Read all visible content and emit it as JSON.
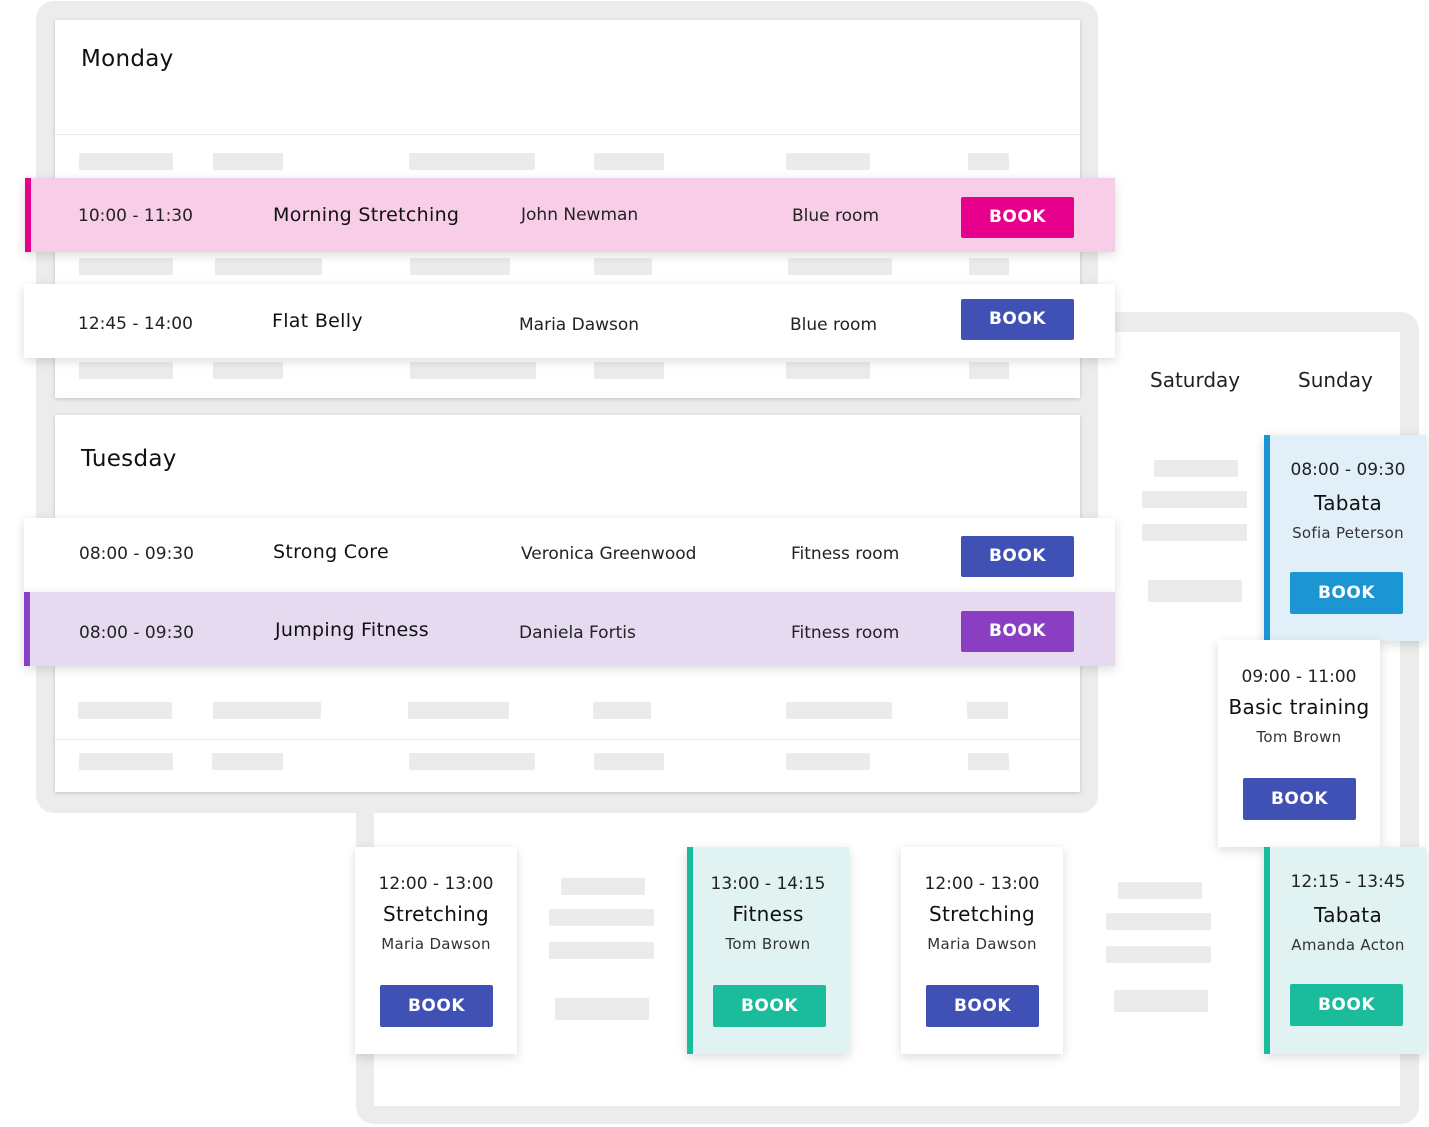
{
  "colors": {
    "magenta": "#e6008c",
    "magenta_bg": "#f8cde8",
    "indigo": "#3f51b5",
    "purple": "#8a3fc2",
    "purple_bg": "#e6daf1",
    "blue": "#1c96d2",
    "blue_bg": "#e1eff8",
    "teal": "#1abc9c",
    "teal_bg": "#e0f2f1"
  },
  "daily": {
    "monday": {
      "title": "Monday",
      "rows": [
        {
          "time": "10:00 - 11:30",
          "name": "Morning Stretching",
          "instructor": "John Newman",
          "room": "Blue room",
          "button": "BOOK"
        },
        {
          "time": "12:45 - 14:00",
          "name": "Flat Belly",
          "instructor": "Maria Dawson",
          "room": "Blue room",
          "button": "BOOK"
        }
      ]
    },
    "tuesday": {
      "title": "Tuesday",
      "rows": [
        {
          "time": "08:00 - 09:30",
          "name": "Strong Core",
          "instructor": "Veronica Greenwood",
          "room": "Fitness room",
          "button": "BOOK"
        },
        {
          "time": "08:00 - 09:30",
          "name": "Jumping Fitness",
          "instructor": "Daniela Fortis",
          "room": "Fitness room",
          "button": "BOOK"
        }
      ]
    }
  },
  "weekly": {
    "headers": [
      "Saturday",
      "Sunday"
    ],
    "cards": [
      {
        "time": "08:00 - 09:30",
        "name": "Tabata",
        "instructor": "Sofia Peterson",
        "button": "BOOK"
      },
      {
        "time": "09:00 - 11:00",
        "name": "Basic training",
        "instructor": "Tom Brown",
        "button": "BOOK"
      },
      {
        "time": "12:00 - 13:00",
        "name": "Stretching",
        "instructor": "Maria Dawson",
        "button": "BOOK"
      },
      {
        "time": "13:00 - 14:15",
        "name": "Fitness",
        "instructor": "Tom Brown",
        "button": "BOOK"
      },
      {
        "time": "12:00 - 13:00",
        "name": "Stretching",
        "instructor": "Maria Dawson",
        "button": "BOOK"
      },
      {
        "time": "12:15 - 13:45",
        "name": "Tabata",
        "instructor": "Amanda Acton",
        "button": "BOOK"
      }
    ]
  }
}
